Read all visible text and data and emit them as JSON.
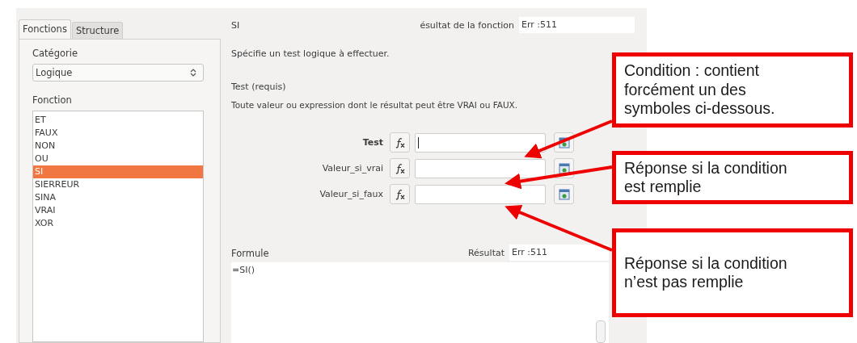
{
  "tabs": [
    {
      "label": "Fonctions",
      "selected": true
    },
    {
      "label": "Structure",
      "selected": false
    }
  ],
  "category": {
    "label": "Catégorie",
    "value": "Logique"
  },
  "function_list": {
    "label": "Fonction",
    "items": [
      {
        "label": "ET",
        "selected": false
      },
      {
        "label": "FAUX",
        "selected": false
      },
      {
        "label": "NON",
        "selected": false
      },
      {
        "label": "OU",
        "selected": false
      },
      {
        "label": "SI",
        "selected": true
      },
      {
        "label": "SIERREUR",
        "selected": false
      },
      {
        "label": "SINA",
        "selected": false
      },
      {
        "label": "VRAI",
        "selected": false
      },
      {
        "label": "XOR",
        "selected": false
      }
    ]
  },
  "function_name": "SI",
  "function_result": {
    "label": "ésultat de la fonction",
    "value": "Err :511"
  },
  "description": "Spécifie un test logique à effectuer.",
  "argument": {
    "title": "Test (requis)",
    "description": "Toute valeur ou expression dont le résultat peut être VRAI ou FAUX."
  },
  "arguments": [
    {
      "label": "Test",
      "active": true
    },
    {
      "label": "Valeur_si_vrai",
      "active": false
    },
    {
      "label": "Valeur_si_faux",
      "active": false
    }
  ],
  "result": {
    "label": "Résultat",
    "value": "Err :511"
  },
  "formula": {
    "label": "Formule",
    "value": "=SI()"
  },
  "callouts": [
    {
      "lines": [
        "Condition : contient",
        "forcément un des",
        "symboles ci-dessous."
      ]
    },
    {
      "lines": [
        "Réponse si la condition",
        "est remplie"
      ]
    },
    {
      "lines": [
        "Réponse si la condition",
        "n’est pas remplie"
      ]
    }
  ]
}
